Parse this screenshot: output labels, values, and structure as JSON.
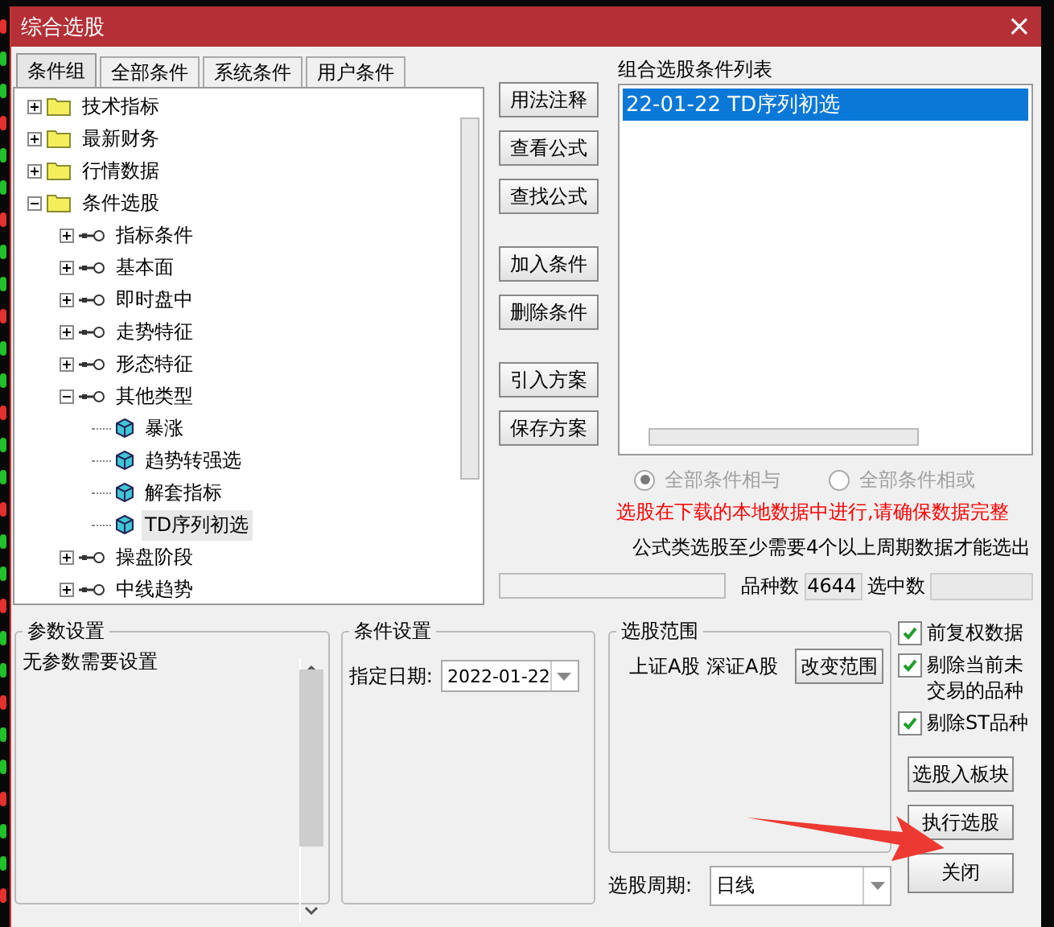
{
  "window": {
    "title": "综合选股",
    "close": "×"
  },
  "tabs": [
    {
      "label": "条件组",
      "selected": true
    },
    {
      "label": "全部条件",
      "selected": false
    },
    {
      "label": "系统条件",
      "selected": false
    },
    {
      "label": "用户条件",
      "selected": false
    }
  ],
  "tree": [
    {
      "label": "技术指标",
      "kind": "folder",
      "expanded": false,
      "selected": false
    },
    {
      "label": "最新财务",
      "kind": "folder",
      "expanded": false,
      "selected": false
    },
    {
      "label": "行情数据",
      "kind": "folder",
      "expanded": false,
      "selected": false
    },
    {
      "label": "条件选股",
      "kind": "folder",
      "expanded": true,
      "selected": false,
      "children": [
        {
          "label": "指标条件",
          "kind": "condition",
          "expanded": false,
          "selected": false
        },
        {
          "label": "基本面",
          "kind": "condition",
          "expanded": false,
          "selected": false
        },
        {
          "label": "即时盘中",
          "kind": "condition",
          "expanded": false,
          "selected": false
        },
        {
          "label": "走势特征",
          "kind": "condition",
          "expanded": false,
          "selected": false
        },
        {
          "label": "形态特征",
          "kind": "condition",
          "expanded": false,
          "selected": false
        },
        {
          "label": "其他类型",
          "kind": "condition",
          "expanded": true,
          "selected": false,
          "children": [
            {
              "label": "暴涨",
              "kind": "formula",
              "selected": false
            },
            {
              "label": "趋势转强选",
              "kind": "formula",
              "selected": false
            },
            {
              "label": "解套指标",
              "kind": "formula",
              "selected": false
            },
            {
              "label": "TD序列初选",
              "kind": "formula",
              "selected": true
            }
          ]
        },
        {
          "label": "操盘阶段",
          "kind": "condition",
          "expanded": false,
          "selected": false
        },
        {
          "label": "中线趋势",
          "kind": "condition",
          "expanded": false,
          "selected": false
        }
      ]
    }
  ],
  "action_buttons": [
    [
      "用法注释",
      "查看公式",
      "查找公式"
    ],
    [
      "加入条件",
      "删除条件"
    ],
    [
      "引入方案",
      "保存方案"
    ]
  ],
  "condition_list": {
    "label": "组合选股条件列表",
    "items": [
      {
        "label": "22-01-22 TD序列初选",
        "selected": true
      }
    ]
  },
  "logic_options": [
    {
      "label": "全部条件相与",
      "selected": true,
      "disabled": true
    },
    {
      "label": "全部条件相或",
      "selected": false,
      "disabled": true
    }
  ],
  "warning": "选股在下载的本地数据中进行,请确保数据完整",
  "note": "公式类选股至少需要4个以上周期数据才能选出",
  "counts": {
    "total_label": "品种数",
    "total": "4644",
    "selected_label": "选中数"
  },
  "params": {
    "title": "参数设置",
    "text": "无参数需要设置"
  },
  "condition_settings": {
    "title": "条件设置",
    "date_label": "指定日期:",
    "date": "2022-01-22"
  },
  "range": {
    "title": "选股范围",
    "text": "上证A股 深证A股",
    "button": "改变范围"
  },
  "period": {
    "label": "选股周期:",
    "value": "日线"
  },
  "options": [
    {
      "label": "前复权数据",
      "checked": true
    },
    {
      "label": "剔除当前未交易的品种",
      "checked": true
    },
    {
      "label": "剔除ST品种",
      "checked": true
    }
  ],
  "bottom_buttons": [
    "选股入板块",
    "执行选股",
    "关闭"
  ]
}
